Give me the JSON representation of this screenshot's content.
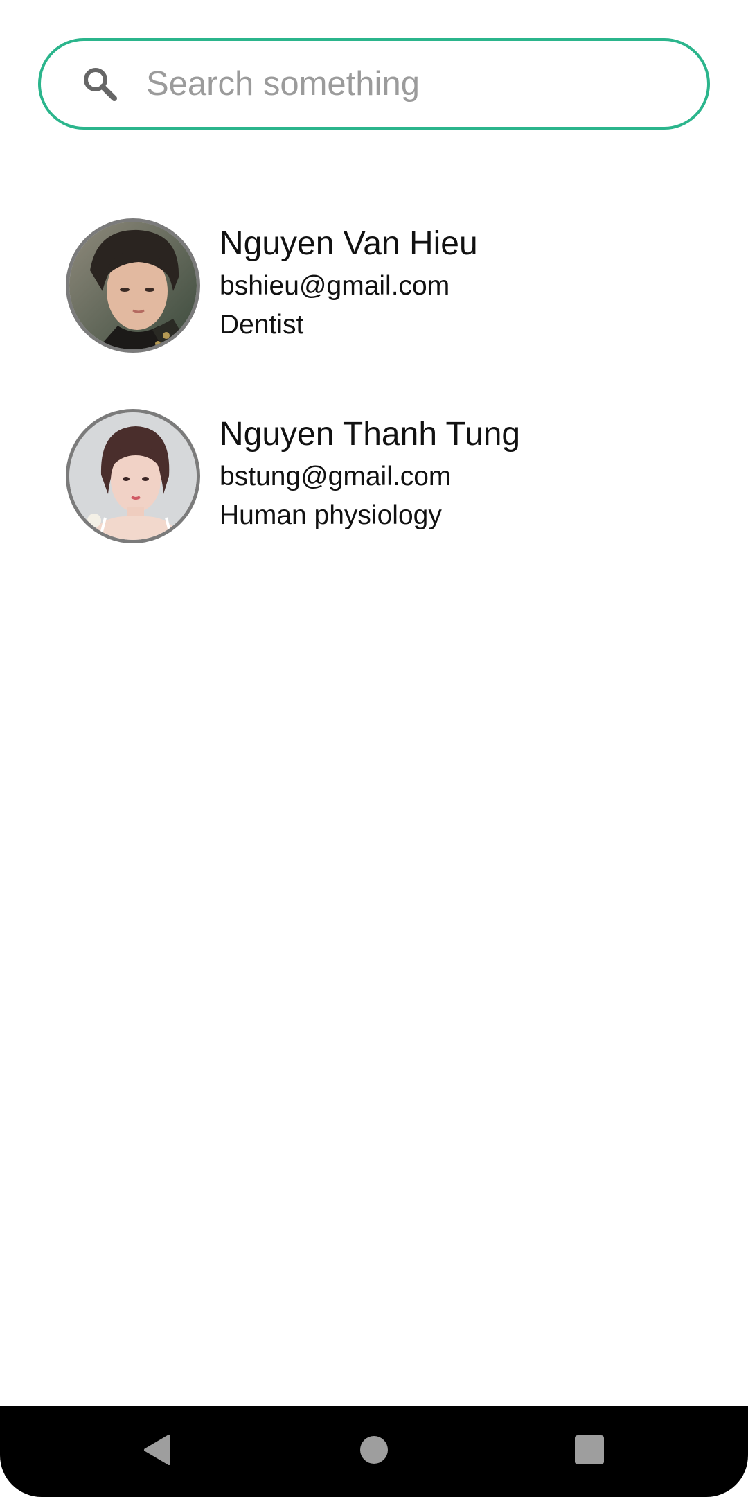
{
  "search": {
    "placeholder": "Search something",
    "value": "",
    "icon": "search-icon",
    "border_color": "#2bb58c"
  },
  "contacts": [
    {
      "name": "Nguyen Van Hieu",
      "email": "bshieu@gmail.com",
      "role": "Dentist",
      "avatar_icon": "avatar"
    },
    {
      "name": "Nguyen Thanh Tung",
      "email": "bstung@gmail.com",
      "role": "Human physiology",
      "avatar_icon": "avatar"
    }
  ],
  "navigation": {
    "back_icon": "back-triangle-icon",
    "home_icon": "home-circle-icon",
    "recents_icon": "recents-square-icon"
  },
  "colors": {
    "accent": "#2bb58c",
    "text": "#111111",
    "placeholder": "#9b9b9b",
    "avatar_border": "#7b7b7b",
    "nav_background": "#000000",
    "nav_icons": "#9e9e9e"
  }
}
